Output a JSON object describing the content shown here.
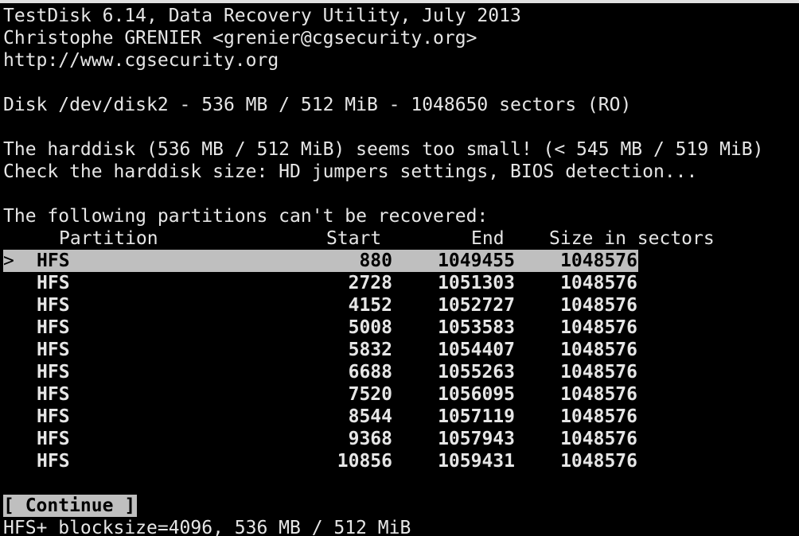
{
  "header": {
    "title": "TestDisk 6.14, Data Recovery Utility, July 2013",
    "author": "Christophe GRENIER <grenier@cgsecurity.org>",
    "url": "http://www.cgsecurity.org"
  },
  "disk_info": "Disk /dev/disk2 - 536 MB / 512 MiB - 1048650 sectors (RO)",
  "warning": {
    "line1": "The harddisk (536 MB / 512 MiB) seems too small! (< 545 MB / 519 MiB)",
    "line2": "Check the harddisk size: HD jumpers settings, BIOS detection..."
  },
  "table": {
    "heading": "The following partitions can't be recovered:",
    "columns": {
      "partition": "Partition",
      "start": "Start",
      "end": "End",
      "size": "Size in sectors"
    },
    "selector": ">",
    "selected_index": 0,
    "rows": [
      {
        "type": "HFS",
        "start": "880",
        "end": "1049455",
        "size": "1048576"
      },
      {
        "type": "HFS",
        "start": "2728",
        "end": "1051303",
        "size": "1048576"
      },
      {
        "type": "HFS",
        "start": "4152",
        "end": "1052727",
        "size": "1048576"
      },
      {
        "type": "HFS",
        "start": "5008",
        "end": "1053583",
        "size": "1048576"
      },
      {
        "type": "HFS",
        "start": "5832",
        "end": "1054407",
        "size": "1048576"
      },
      {
        "type": "HFS",
        "start": "6688",
        "end": "1055263",
        "size": "1048576"
      },
      {
        "type": "HFS",
        "start": "7520",
        "end": "1056095",
        "size": "1048576"
      },
      {
        "type": "HFS",
        "start": "8544",
        "end": "1057119",
        "size": "1048576"
      },
      {
        "type": "HFS",
        "start": "9368",
        "end": "1057943",
        "size": "1048576"
      },
      {
        "type": "HFS",
        "start": "10856",
        "end": "1059431",
        "size": "1048576"
      }
    ]
  },
  "continue_label": "[ Continue ]",
  "status_line": "HFS+ blocksize=4096, 536 MB / 512 MiB",
  "colors": {
    "background": "#000000",
    "foreground": "#e6e6e6",
    "highlight": "#bfbfbf"
  }
}
